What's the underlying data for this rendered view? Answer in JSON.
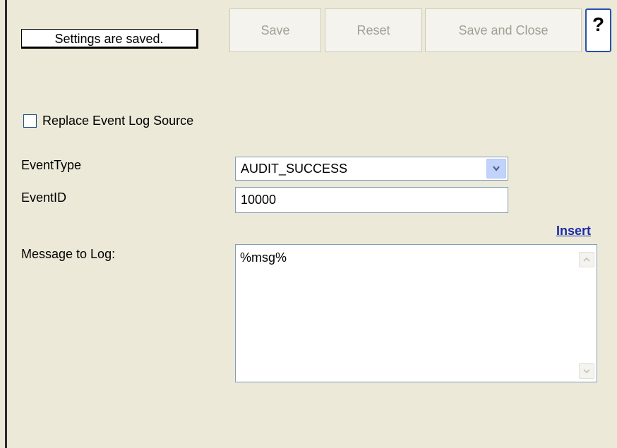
{
  "status": {
    "text": "Settings are saved."
  },
  "toolbar": {
    "save_label": "Save",
    "reset_label": "Reset",
    "save_close_label": "Save and Close",
    "help_label": "?"
  },
  "form": {
    "replace_source_label": "Replace Event Log Source",
    "replace_source_checked": false,
    "event_type_label": "EventType",
    "event_type_value": "AUDIT_SUCCESS",
    "event_id_label": "EventID",
    "event_id_value": "10000",
    "message_label": "Message to Log:",
    "insert_label": "Insert",
    "message_value": "%msg%"
  },
  "icons": {
    "dropdown": "chevron-down-icon",
    "scroll_up": "scroll-up-icon",
    "scroll_down": "scroll-down-icon"
  },
  "colors": {
    "panel_bg": "#ece9d8",
    "link": "#1a2aa8",
    "input_border": "#7f9db9",
    "help_border": "#2a4fb0"
  }
}
